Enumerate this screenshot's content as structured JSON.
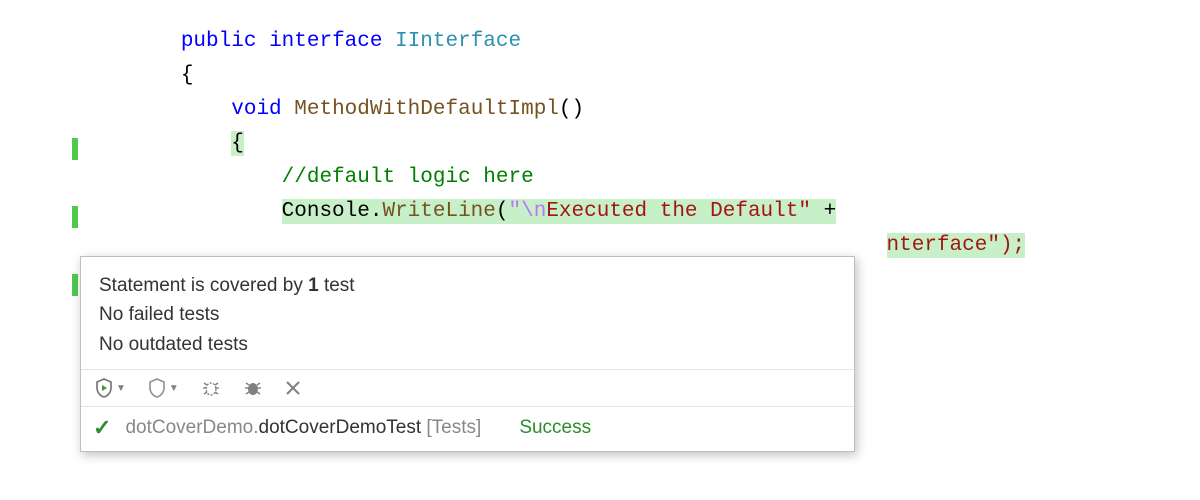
{
  "code": {
    "l1": {
      "kw1": "public",
      "kw2": "interface",
      "type": "IInterface"
    },
    "l2": {
      "brace": "{"
    },
    "l3": {
      "kw": "void",
      "method": "MethodWithDefaultImpl",
      "parens": "()"
    },
    "l4": {
      "brace": "{"
    },
    "l5": {
      "comment": "//default logic here"
    },
    "l6": {
      "obj": "Console",
      "dot": ".",
      "method": "WriteLine",
      "open": "(",
      "esc": "\"\\n",
      "str": "Executed the Default\"",
      "plus": " +"
    },
    "l7": {
      "tail": "nterface\");"
    }
  },
  "tooltip": {
    "line1_a": "Statement is covered by ",
    "line1_b": "1",
    "line1_c": " test",
    "line2": "No failed tests",
    "line3": "No outdated tests"
  },
  "status": {
    "namespace": "dotCoverDemo.",
    "class": "dotCoverDemoTest",
    "suffix": " [Tests]",
    "result": "Success"
  },
  "icons": {
    "shield_run": "shield-run-icon",
    "shield": "shield-icon",
    "bug1": "bug-icon",
    "bug2": "bug-breakpoint-icon",
    "close": "close-icon",
    "check": "check-icon"
  }
}
